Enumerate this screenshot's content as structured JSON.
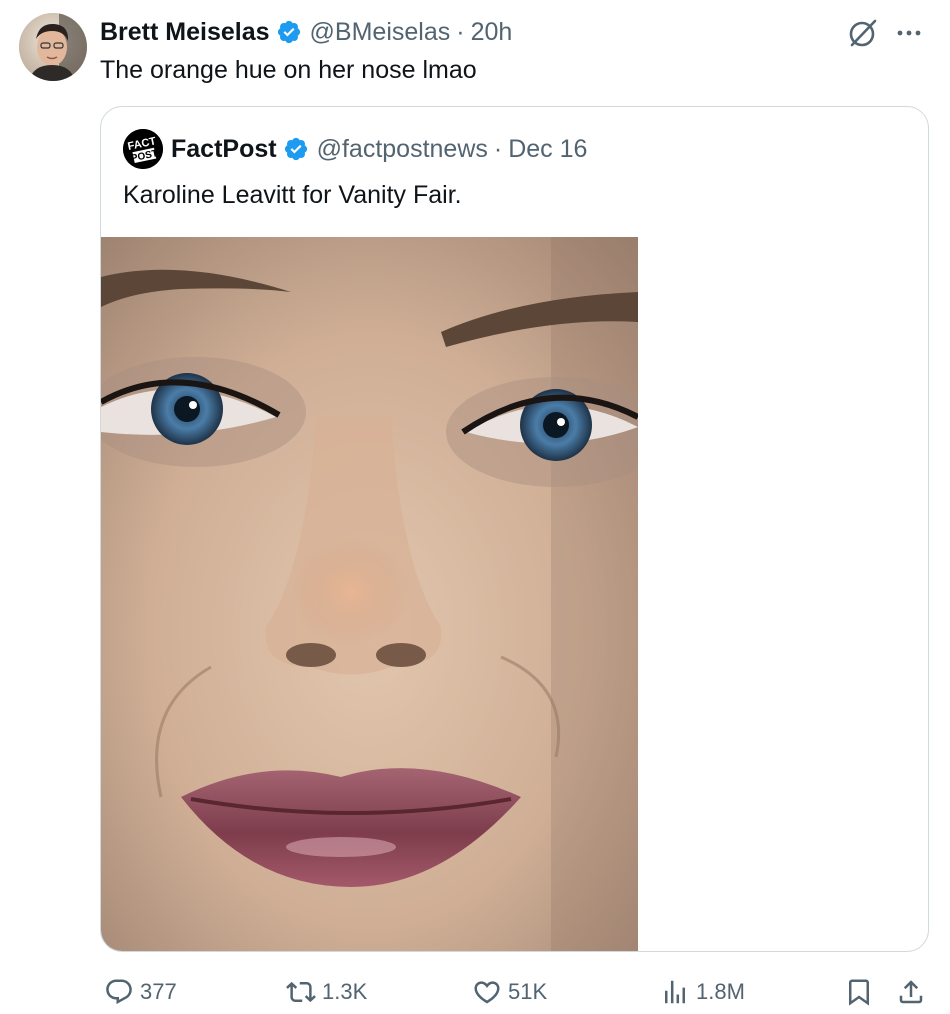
{
  "author": {
    "name": "Brett Meiselas",
    "handle": "@BMeiselas",
    "time": "20h",
    "dot": "·",
    "verified": true,
    "avatar_icon": "profile-photo"
  },
  "tweet": {
    "text": "The orange hue on her nose lmao"
  },
  "quoted": {
    "name": "FactPost",
    "handle": "@factpostnews",
    "date": "Dec 16",
    "dot": "·",
    "verified": true,
    "avatar_logo_text": [
      "FACT",
      "POST"
    ],
    "text": "Karoline Leavitt for Vanity Fair.",
    "image_icon": "portrait-photo"
  },
  "actions": {
    "replies": "377",
    "reposts": "1.3K",
    "likes": "51K",
    "views": "1.8M"
  },
  "icons": {
    "verified": "verified-badge-icon",
    "grok": "grok-icon",
    "more": "more-icon",
    "reply": "reply-icon",
    "repost": "repost-icon",
    "like": "like-icon",
    "views": "views-icon",
    "bookmark": "bookmark-icon",
    "share": "share-icon"
  },
  "colors": {
    "text_primary": "#0f1419",
    "text_secondary": "#536471",
    "verified_blue": "#1d9bf0",
    "border": "#cfd9de"
  }
}
